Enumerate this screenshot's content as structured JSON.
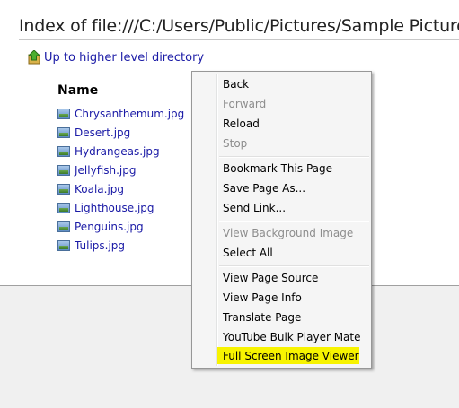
{
  "page": {
    "title": "Index of file:///C:/Users/Public/Pictures/Sample Pictures",
    "up_link": "Up to higher level directory",
    "column_header": "Name",
    "files": [
      "Chrysanthemum.jpg",
      "Desert.jpg",
      "Hydrangeas.jpg",
      "Jellyfish.jpg",
      "Koala.jpg",
      "Lighthouse.jpg",
      "Penguins.jpg",
      "Tulips.jpg"
    ]
  },
  "context_menu": {
    "back": "Back",
    "forward": "Forward",
    "reload": "Reload",
    "stop": "Stop",
    "bookmark": "Bookmark This Page",
    "save_as": "Save Page As...",
    "send_link": "Send Link...",
    "view_bg_image": "View Background Image",
    "select_all": "Select All",
    "view_source": "View Page Source",
    "view_info": "View Page Info",
    "translate": "Translate Page",
    "youtube": "YouTube Bulk Player Mate",
    "fullscreen": "Full Screen Image Viewer",
    "highlight_color": "#f7f300"
  }
}
